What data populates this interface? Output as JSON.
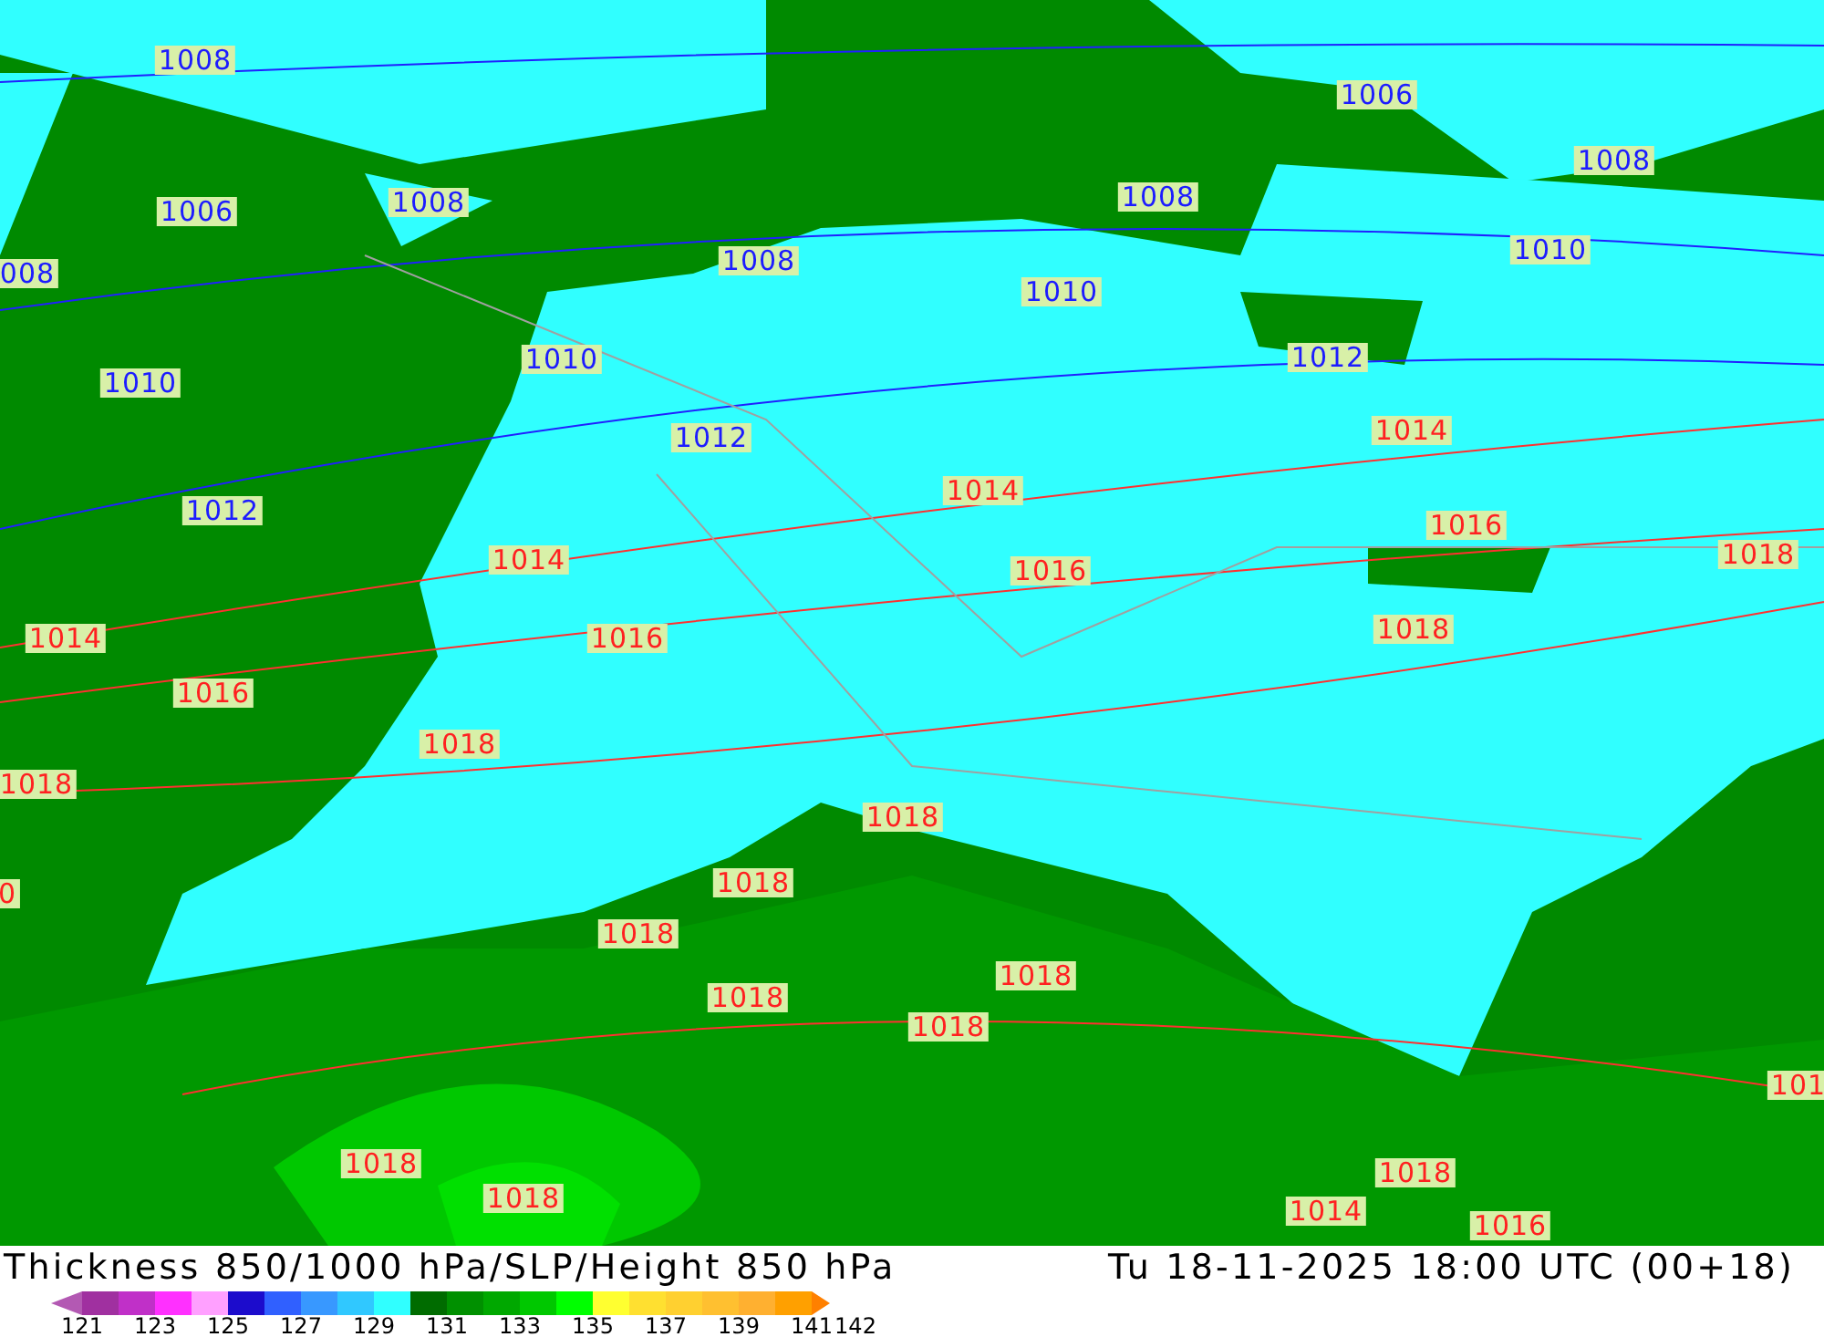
{
  "map": {
    "labels": [
      {
        "text": "1008",
        "kind": "low"
      },
      {
        "text": "1006",
        "kind": "low"
      },
      {
        "text": "1008",
        "kind": "low"
      },
      {
        "text": "1006",
        "kind": "low"
      },
      {
        "text": "1008",
        "kind": "low"
      },
      {
        "text": "1008",
        "kind": "low"
      },
      {
        "text": "008",
        "kind": "low"
      },
      {
        "text": "1008",
        "kind": "low"
      },
      {
        "text": "1010",
        "kind": "low"
      },
      {
        "text": "1010",
        "kind": "low"
      },
      {
        "text": "1010",
        "kind": "low"
      },
      {
        "text": "1012",
        "kind": "low"
      },
      {
        "text": "1010",
        "kind": "low"
      },
      {
        "text": "1012",
        "kind": "low"
      },
      {
        "text": "1014",
        "kind": "high"
      },
      {
        "text": "1014",
        "kind": "high"
      },
      {
        "text": "1012",
        "kind": "low"
      },
      {
        "text": "1016",
        "kind": "high"
      },
      {
        "text": "1014",
        "kind": "high"
      },
      {
        "text": "1018",
        "kind": "high"
      },
      {
        "text": "1016",
        "kind": "high"
      },
      {
        "text": "1014",
        "kind": "high"
      },
      {
        "text": "1016",
        "kind": "high"
      },
      {
        "text": "1018",
        "kind": "high"
      },
      {
        "text": "1016",
        "kind": "high"
      },
      {
        "text": "1018",
        "kind": "high"
      },
      {
        "text": "1018",
        "kind": "high"
      },
      {
        "text": "1018",
        "kind": "high"
      },
      {
        "text": "0",
        "kind": "high"
      },
      {
        "text": "1018",
        "kind": "high"
      },
      {
        "text": "1018",
        "kind": "high"
      },
      {
        "text": "1018",
        "kind": "high"
      },
      {
        "text": "1018",
        "kind": "high"
      },
      {
        "text": "1018",
        "kind": "high"
      },
      {
        "text": "101",
        "kind": "high"
      },
      {
        "text": "1018",
        "kind": "high"
      },
      {
        "text": "1018",
        "kind": "high"
      },
      {
        "text": "1018",
        "kind": "high"
      },
      {
        "text": "1014",
        "kind": "high"
      },
      {
        "text": "1016",
        "kind": "high"
      }
    ]
  },
  "footer": {
    "title": "Thickness 850/1000 hPa/SLP/Height 850 hPa",
    "datetime": "Tu 18-11-2025 18:00 UTC (00+18)"
  },
  "legend": {
    "swatches": [
      {
        "color": "#a030a0"
      },
      {
        "color": "#c030c8"
      },
      {
        "color": "#ff30ff"
      },
      {
        "color": "#ffa0ff"
      },
      {
        "color": "#1c0ccc"
      },
      {
        "color": "#3060ff"
      },
      {
        "color": "#3898ff"
      },
      {
        "color": "#30c8ff"
      },
      {
        "color": "#30ffff"
      },
      {
        "color": "#006c00"
      },
      {
        "color": "#009000"
      },
      {
        "color": "#00a800"
      },
      {
        "color": "#00c800"
      },
      {
        "color": "#00ff00"
      },
      {
        "color": "#ffff30"
      },
      {
        "color": "#ffe030"
      },
      {
        "color": "#ffd030"
      },
      {
        "color": "#ffc030"
      },
      {
        "color": "#ffb030"
      },
      {
        "color": "#ffa000"
      }
    ],
    "ticks": [
      "121",
      "123",
      "125",
      "127",
      "129",
      "131",
      "133",
      "135",
      "137",
      "139",
      "141",
      "142"
    ]
  }
}
